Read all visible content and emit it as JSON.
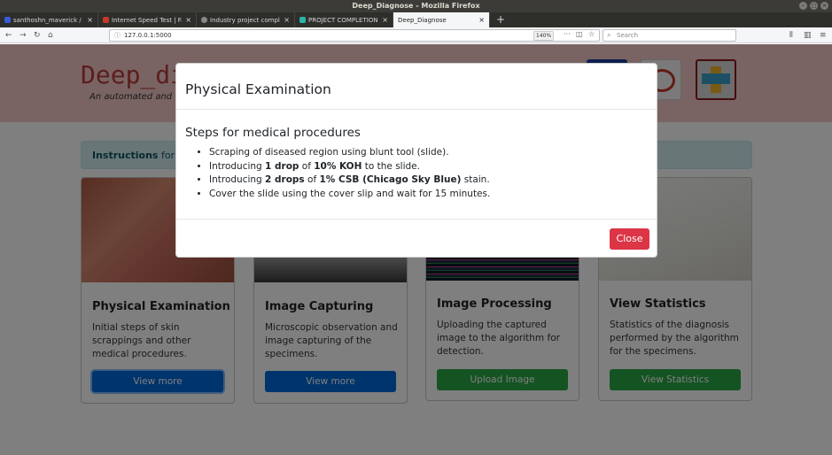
{
  "window": {
    "title": "Deep_Diagnose - Mozilla Firefox"
  },
  "tabs": [
    {
      "label": "santhoshn_maverick / d",
      "favicon_color": "#3b5bdb",
      "active": false
    },
    {
      "label": "Internet Speed Test | Fa",
      "favicon_color": "#c0392b",
      "active": false
    },
    {
      "label": "Industry project comple",
      "favicon_color": "#888888",
      "active": false
    },
    {
      "label": "PROJECT COMPLETION",
      "favicon_color": "#2bb5a8",
      "active": false
    },
    {
      "label": "Deep_Diagnose",
      "favicon_color": "#dddddd",
      "active": true
    }
  ],
  "nav": {
    "url": "127.0.0.1:5000",
    "zoom": "140%",
    "search_placeholder": "Search"
  },
  "site": {
    "brand": "Deep_di",
    "tagline": "An automated and"
  },
  "instructions": {
    "label": "Instructions",
    "text": " for w"
  },
  "cards": [
    {
      "title": "Physical Examination",
      "text": "Initial steps of skin scrappings and other medical procedures.",
      "button": "View more"
    },
    {
      "title": "Image Capturing",
      "text": "Microscopic observation and image capturing of the specimens.",
      "button": "View more"
    },
    {
      "title": "Image Processing",
      "text": "Uploading the captured image to the algorithm for detection.",
      "button": "Upload Image"
    },
    {
      "title": "View Statistics",
      "text": "Statistics of the diagnosis performed by the algorithm for the specimens.",
      "button": "View Statistics"
    }
  ],
  "modal": {
    "title": "Physical Examination",
    "subtitle": "Steps for medical procedures",
    "steps": {
      "s1": "Scraping of diseased region using blunt tool (slide).",
      "s2": {
        "a": "Introducing ",
        "b": "1 drop",
        "c": " of ",
        "d": "10% KOH",
        "e": " to the slide."
      },
      "s3": {
        "a": "Introducing ",
        "b": "2 drops",
        "c": " of ",
        "d": "1% CSB (Chicago Sky Blue)",
        "e": " stain."
      },
      "s4": "Cover the slide using the cover slip and wait for 15 minutes."
    },
    "close_label": "Close"
  },
  "colors": {
    "header_bg": "#f3c8c6",
    "brand": "#b83a3a",
    "primary": "#0069d9",
    "success": "#28a745",
    "danger": "#dc3545"
  }
}
